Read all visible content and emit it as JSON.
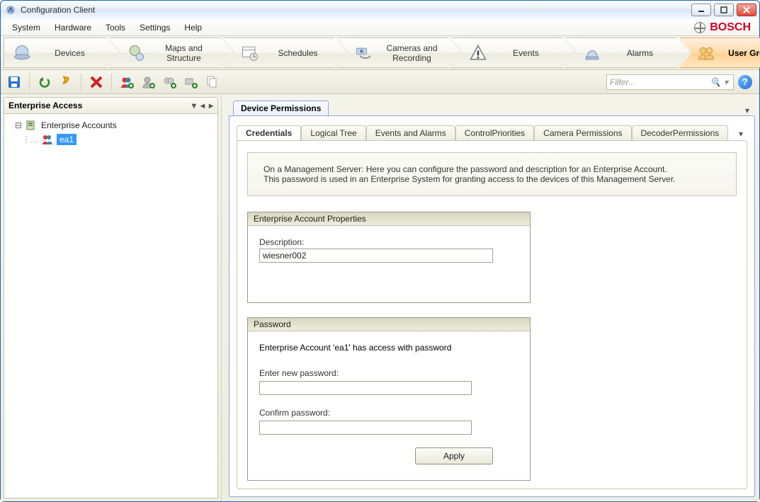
{
  "window": {
    "title": "Configuration Client"
  },
  "menu": {
    "items": [
      "System",
      "Hardware",
      "Tools",
      "Settings",
      "Help"
    ]
  },
  "brand": {
    "name": "BOSCH"
  },
  "workflow": {
    "steps": [
      {
        "label": "Devices"
      },
      {
        "label": "Maps and Structure"
      },
      {
        "label": "Schedules"
      },
      {
        "label": "Cameras and Recording"
      },
      {
        "label": "Events"
      },
      {
        "label": "Alarms"
      },
      {
        "label": "User Groups"
      }
    ]
  },
  "toolbar": {
    "filter_placeholder": "Filter..."
  },
  "left": {
    "title": "Enterprise Access",
    "root": "Enterprise Accounts",
    "child": "ea1"
  },
  "right": {
    "outer_tab": "Device Permissions",
    "inner_tabs": [
      "Credentials",
      "Logical Tree",
      "Events and Alarms",
      "ControlPriorities",
      "Camera Permissions",
      "DecoderPermissions"
    ],
    "info_line1": "On a Management Server: Here you can configure the password and description for an Enterprise Account.",
    "info_line2": "This password is used in an Enterprise System for granting access to the devices of this Management Server.",
    "group_props_title": "Enterprise Account Properties",
    "description_label": "Description:",
    "description_value": "wiesner002",
    "group_pwd_title": "Password",
    "access_text": "Enterprise Account 'ea1' has access with password",
    "new_pwd_label": "Enter new password:",
    "confirm_pwd_label": "Confirm password:",
    "apply_label": "Apply",
    "new_pwd_value": "",
    "confirm_pwd_value": ""
  }
}
